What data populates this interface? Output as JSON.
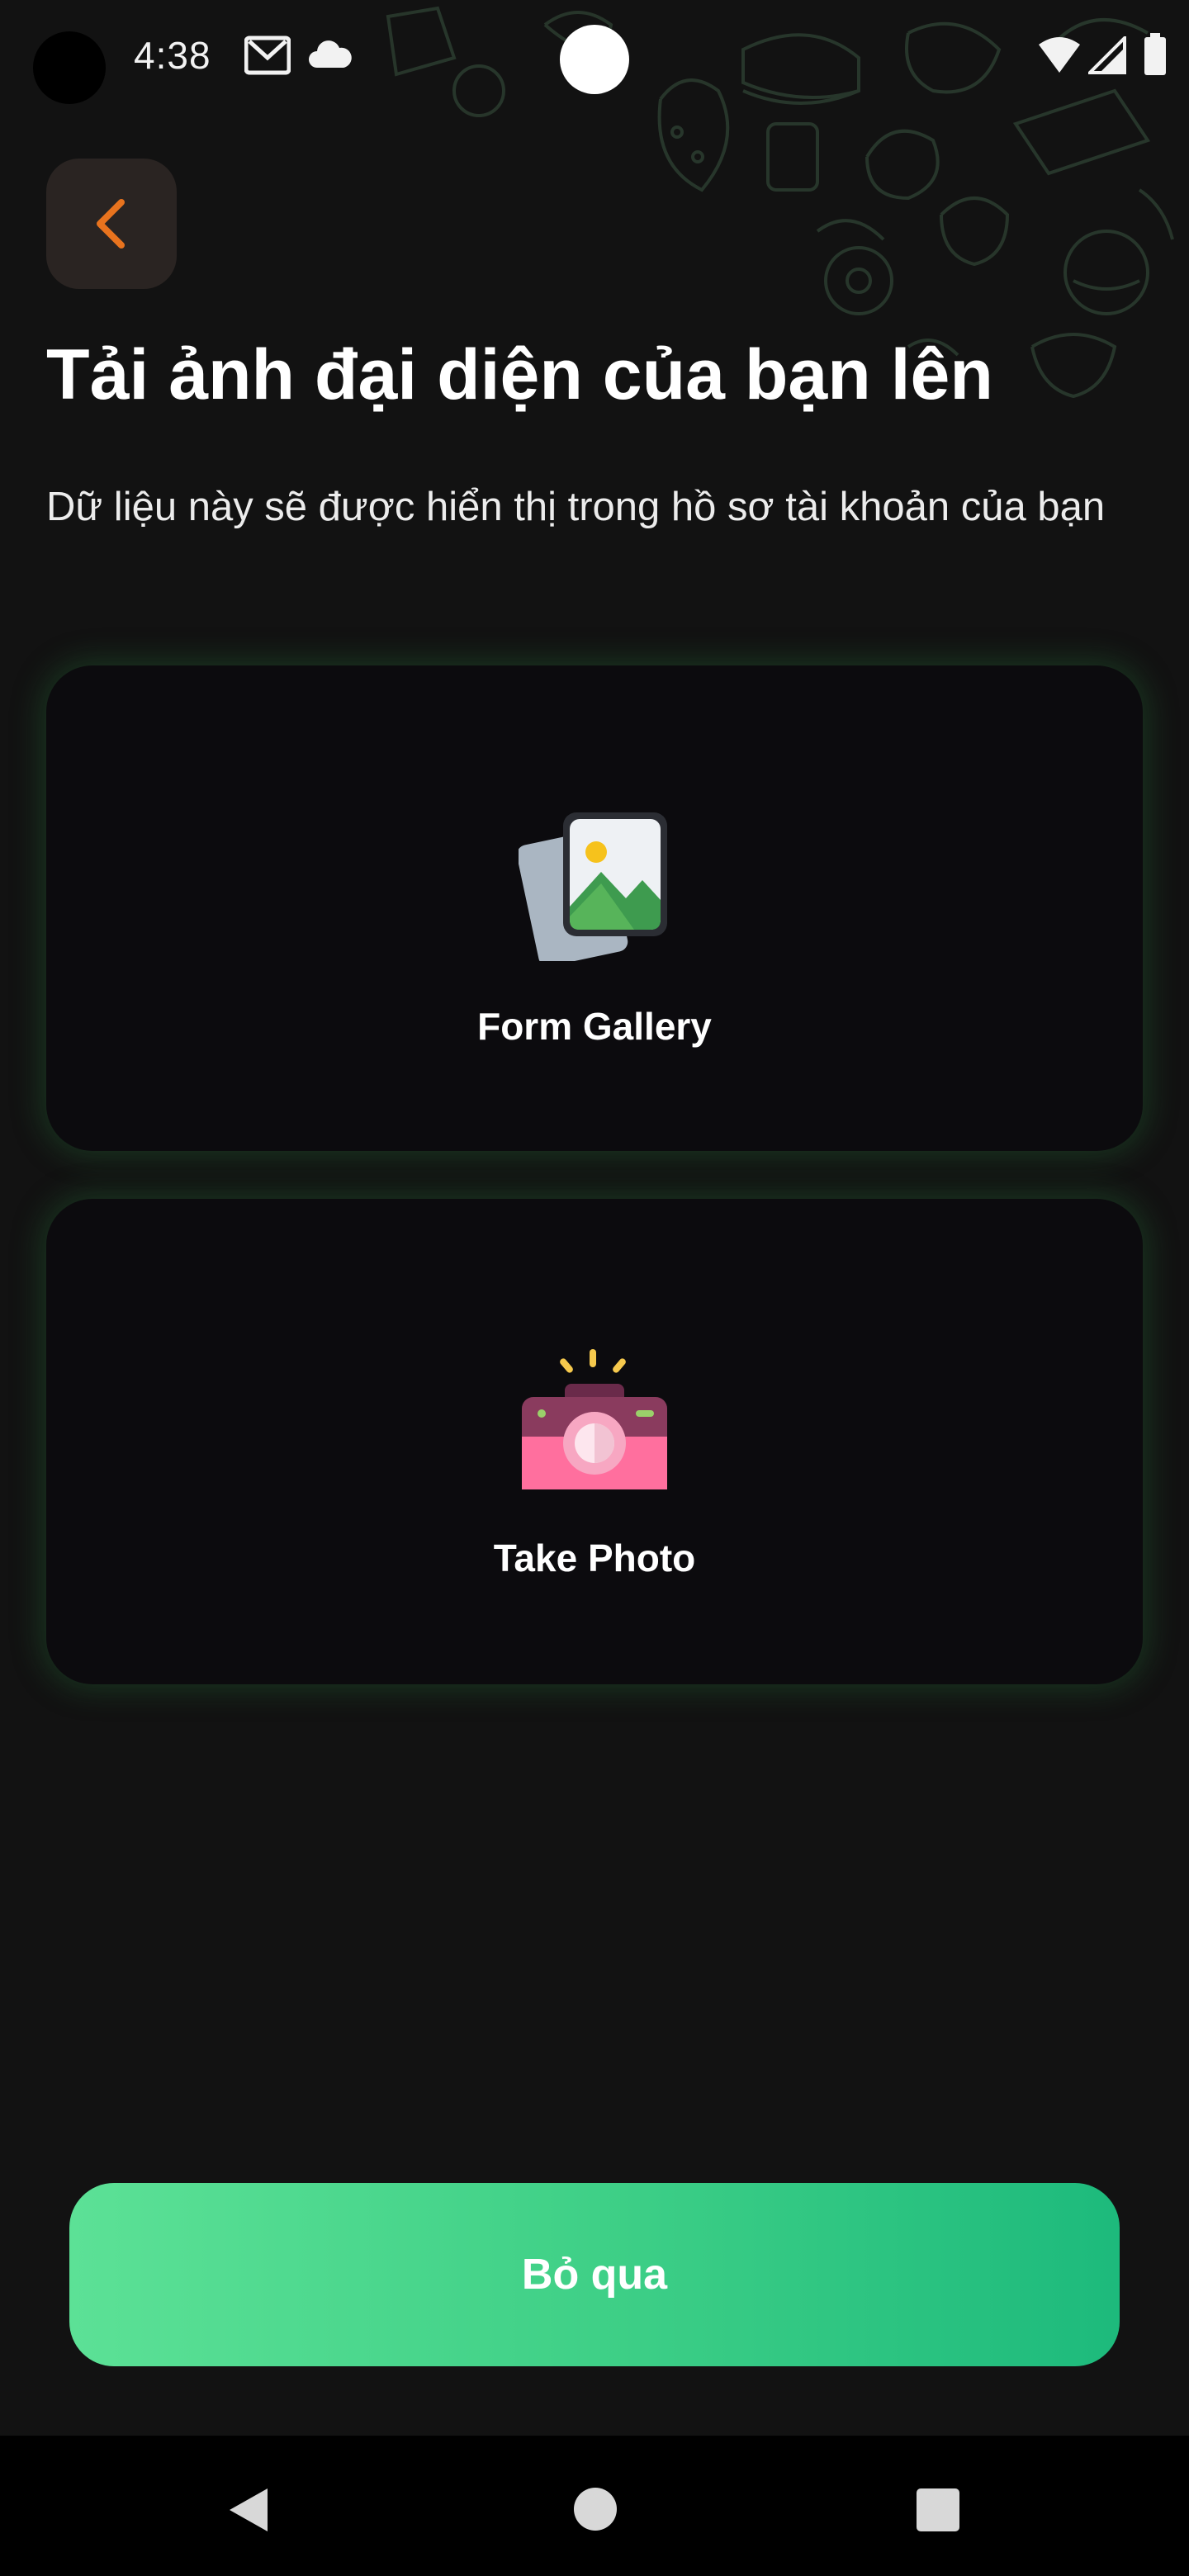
{
  "status_bar": {
    "time": "4:38"
  },
  "header": {
    "title": "Tải ảnh đại diện của bạn lên",
    "subtitle": "Dữ liệu này sẽ được hiển thị trong hồ sơ tài khoản của bạn"
  },
  "options": [
    {
      "label": "Form Gallery",
      "icon": "gallery-icon"
    },
    {
      "label": "Take Photo",
      "icon": "camera-icon"
    }
  ],
  "skip_button": {
    "label": "Bỏ qua"
  },
  "colors": {
    "background": "#121212",
    "accent_back": "#e8731e",
    "button_gradient_start": "#5ce196",
    "button_gradient_end": "#1dba7c"
  }
}
